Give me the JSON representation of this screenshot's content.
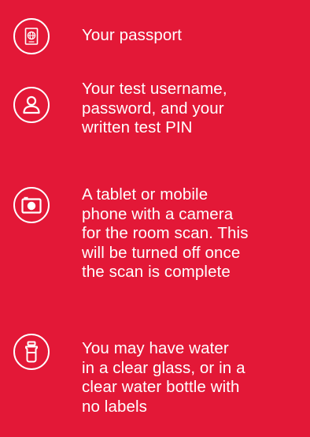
{
  "checklist": {
    "items": [
      {
        "icon": "passport-icon",
        "text": "Your passport"
      },
      {
        "icon": "user-icon",
        "text": "Your test username,\npassword, and your\nwritten test PIN"
      },
      {
        "icon": "camera-icon",
        "text": "A tablet or mobile\nphone with a camera\nfor the room scan. This\nwill be turned off once\nthe scan is complete"
      },
      {
        "icon": "water-bottle-icon",
        "text": "You may have water\nin a clear glass, or in a\nclear water bottle with\nno labels"
      }
    ]
  },
  "colors": {
    "background": "#e31837",
    "foreground": "#ffffff"
  }
}
